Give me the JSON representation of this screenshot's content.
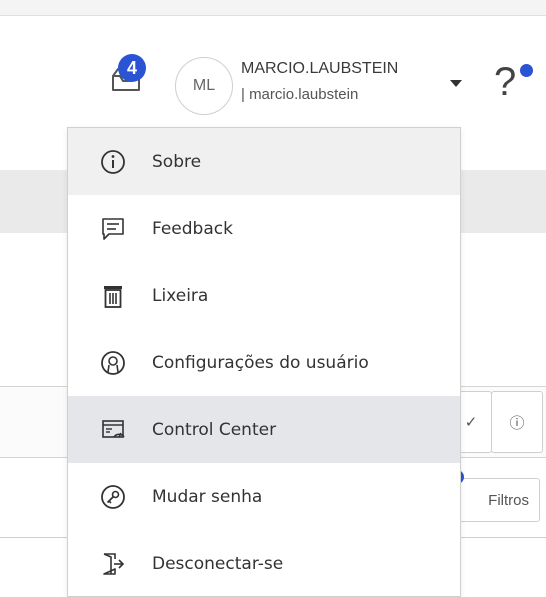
{
  "header": {
    "notification_count": "4",
    "avatar_initials": "ML",
    "user_display_name": "MARCIO.LAUBSTEIN",
    "user_login": "| marcio.laubstein",
    "help_label": "?"
  },
  "menu": {
    "items": [
      {
        "label": "Sobre",
        "icon": "info-icon"
      },
      {
        "label": "Feedback",
        "icon": "feedback-icon"
      },
      {
        "label": "Lixeira",
        "icon": "trash-icon"
      },
      {
        "label": "Configurações do usuário",
        "icon": "user-settings-icon"
      },
      {
        "label": "Control Center",
        "icon": "control-center-icon"
      },
      {
        "label": "Mudar senha",
        "icon": "key-icon"
      },
      {
        "label": "Desconectar-se",
        "icon": "logout-icon"
      }
    ]
  },
  "background": {
    "check_label": "✓",
    "info_label": "ⓘ",
    "filters_label": "Filtros"
  },
  "colors": {
    "accent": "#2a54d4",
    "menu_highlight": "#e4e6e9"
  }
}
